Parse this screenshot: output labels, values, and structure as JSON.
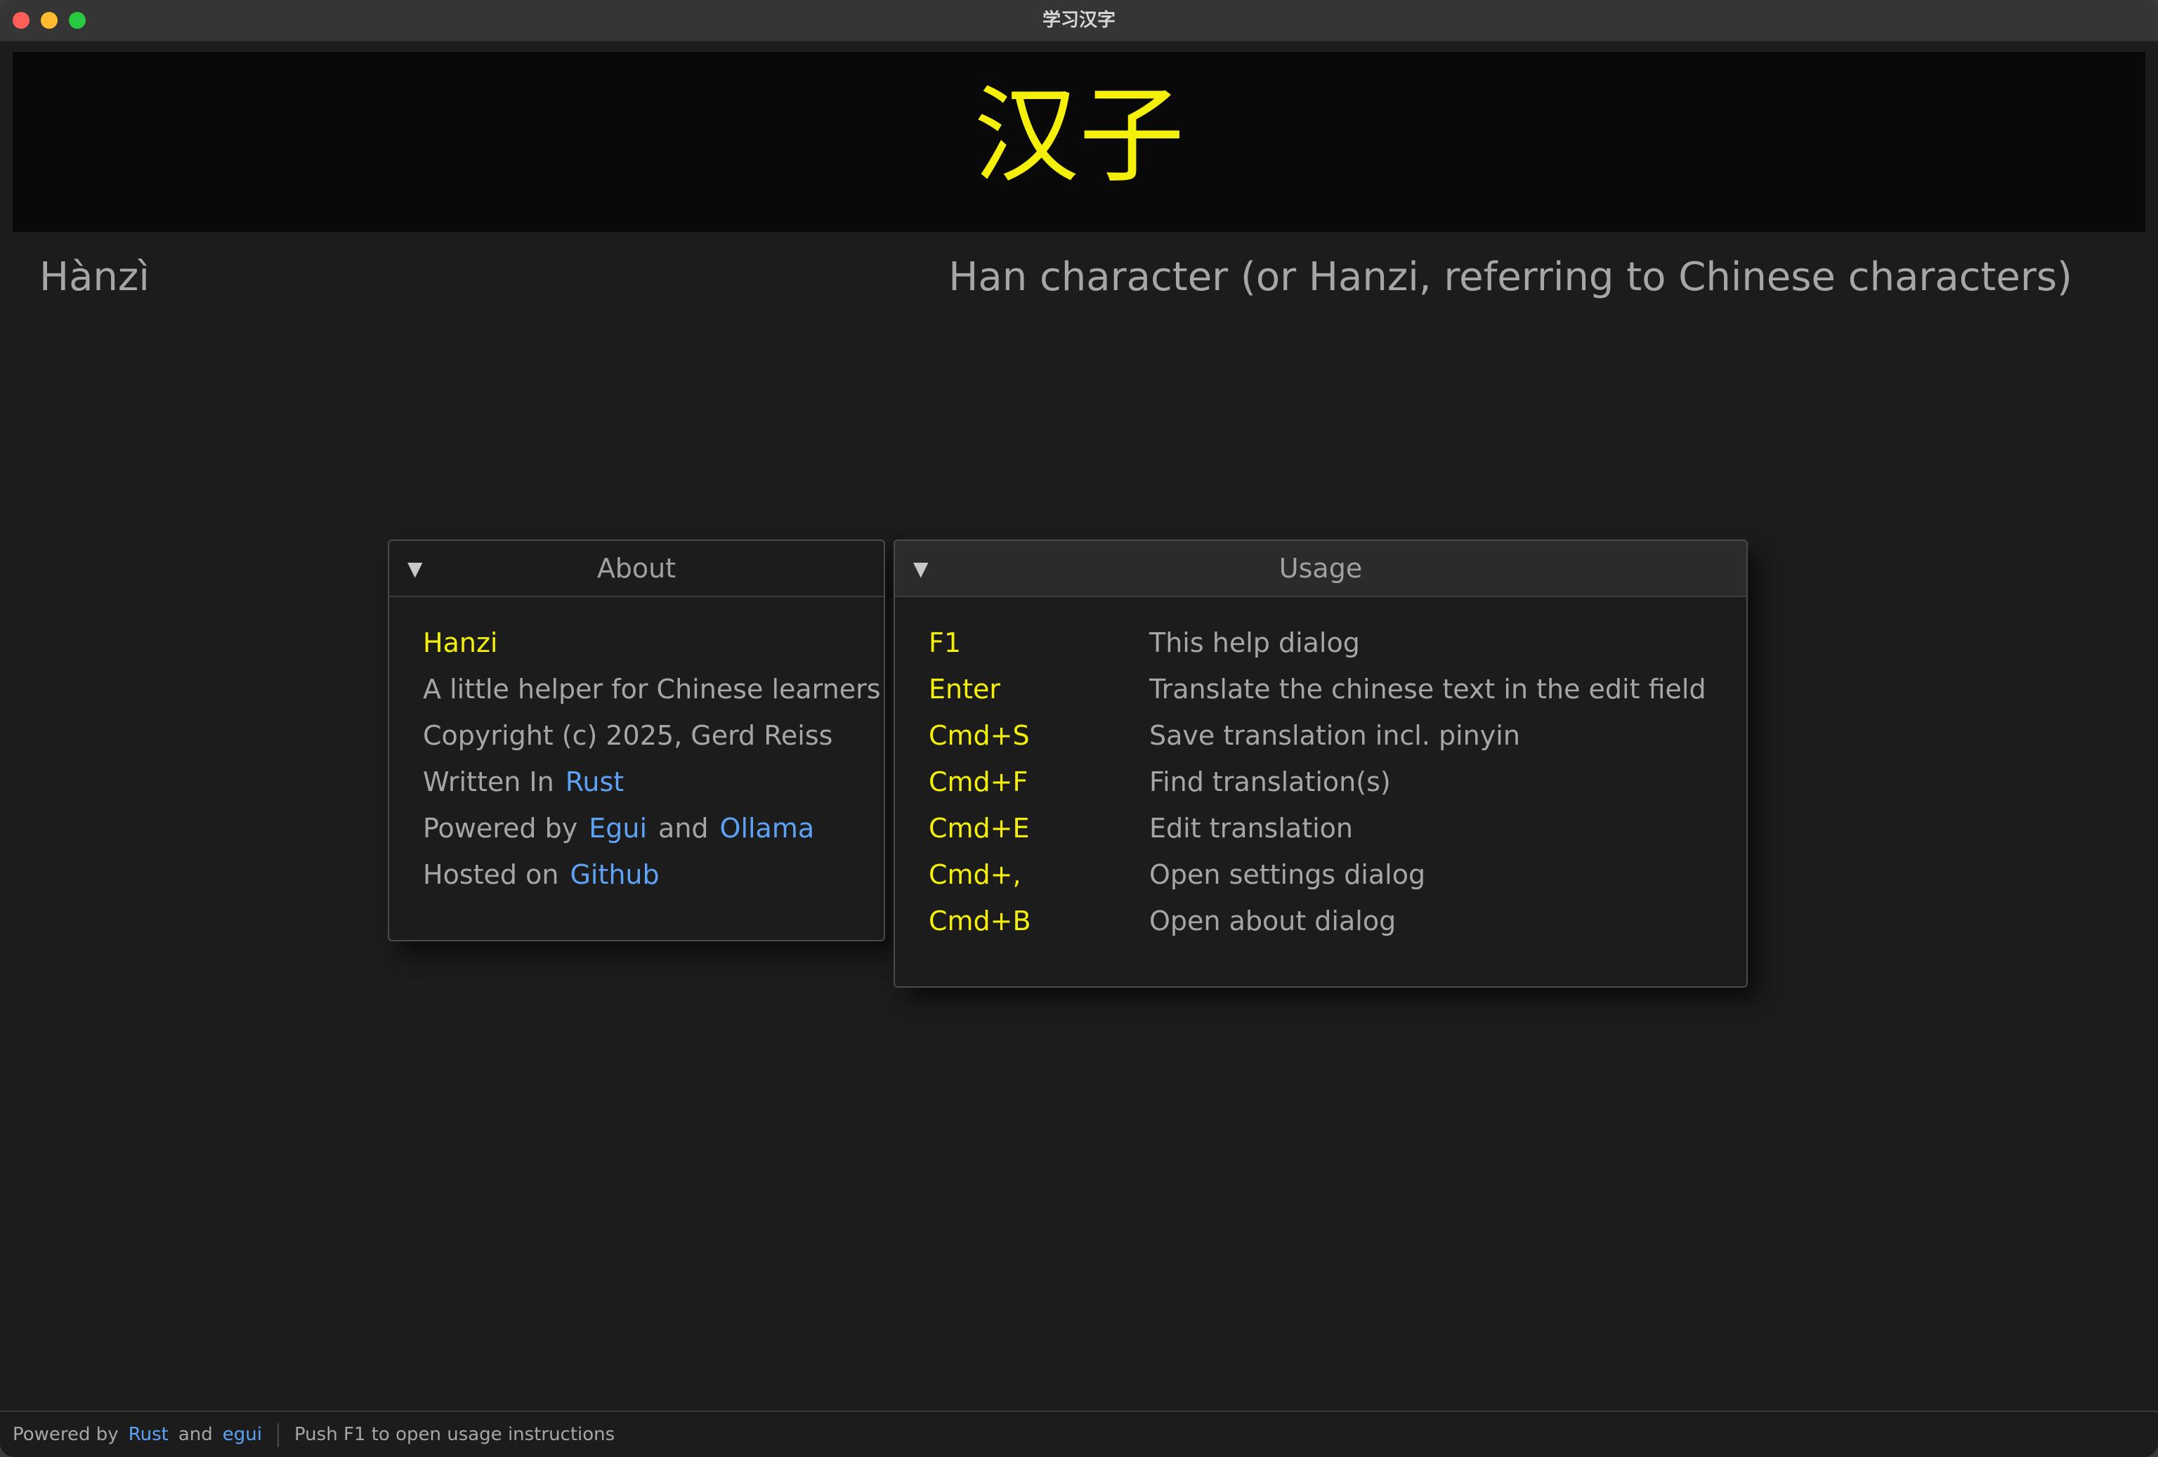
{
  "window": {
    "title": "学习汉字"
  },
  "header": {
    "character": "汉子",
    "pinyin": "Hànzì",
    "translation": "Han character (or Hanzi, referring to Chinese characters)"
  },
  "about_panel": {
    "title": "About",
    "collapse_icon": "▼",
    "app_name": "Hanzi",
    "tagline": "A little helper for Chinese learners",
    "copyright": "Copyright (c) 2025, Gerd Reiss",
    "written_in_label": "Written In",
    "written_in_link": "Rust",
    "powered_by_label": "Powered by",
    "powered_by_link1": "Egui",
    "powered_by_and": "and",
    "powered_by_link2": "Ollama",
    "hosted_on_label": "Hosted on",
    "hosted_on_link": "Github"
  },
  "usage_panel": {
    "title": "Usage",
    "collapse_icon": "▼",
    "shortcuts": [
      {
        "key": "F1",
        "description": "This help dialog"
      },
      {
        "key": "Enter",
        "description": "Translate the chinese text in the edit field"
      },
      {
        "key": "Cmd+S",
        "description": "Save translation incl. pinyin"
      },
      {
        "key": "Cmd+F",
        "description": "Find translation(s)"
      },
      {
        "key": "Cmd+E",
        "description": "Edit translation"
      },
      {
        "key": "Cmd+,",
        "description": "Open settings dialog"
      },
      {
        "key": "Cmd+B",
        "description": "Open about dialog"
      }
    ]
  },
  "statusbar": {
    "powered_by": "Powered by",
    "link1": "Rust",
    "and": "and",
    "link2": "egui",
    "hint": "Push F1 to open usage instructions"
  },
  "colors": {
    "accent_yellow": "#f5f00a",
    "link_blue": "#5da2f5",
    "text_gray": "#a6a6a6",
    "background": "#1c1c1c"
  }
}
